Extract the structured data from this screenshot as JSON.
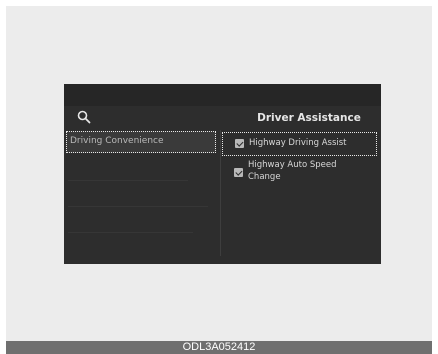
{
  "screen": {
    "title": "Driver Assistance",
    "search_icon": "search-icon",
    "left_menu": {
      "selected_item": "Driving Convenience"
    },
    "options": [
      {
        "label": "Highway Driving Assist",
        "checked": true,
        "focused": true
      },
      {
        "label": "Highway Auto Speed Change",
        "checked": true,
        "focused": false
      }
    ]
  },
  "caption": "ODL3A052412"
}
